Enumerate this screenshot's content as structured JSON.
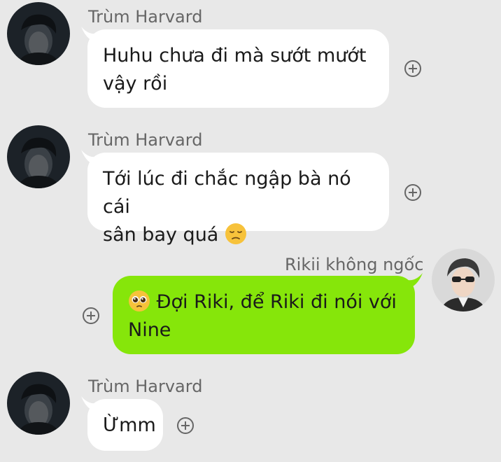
{
  "messages": [
    {
      "sender": "Trùm Harvard",
      "direction": "incoming",
      "lines": [
        "Huhu chưa đi mà sướt mướt",
        "vậy rồi"
      ]
    },
    {
      "sender": "Trùm Harvard",
      "direction": "incoming",
      "lines": [
        "Tới lúc đi chắc ngập bà nó cái",
        "sân bay quá"
      ],
      "emoji": "pensive-face"
    },
    {
      "sender": "Rikii không ngốc",
      "direction": "outgoing",
      "emoji": "pleading-face",
      "lines": [
        "Đợi Riki, để Riki đi nói với",
        "Nine"
      ]
    },
    {
      "sender": "Trùm Harvard",
      "direction": "incoming",
      "lines": [
        "Ừmm"
      ]
    }
  ],
  "icons": {
    "add_reaction": "plus-circle-icon"
  },
  "colors": {
    "background": "#e8e8e8",
    "incoming_bubble": "#ffffff",
    "outgoing_bubble": "#86e60a",
    "sender_text": "#666666"
  }
}
